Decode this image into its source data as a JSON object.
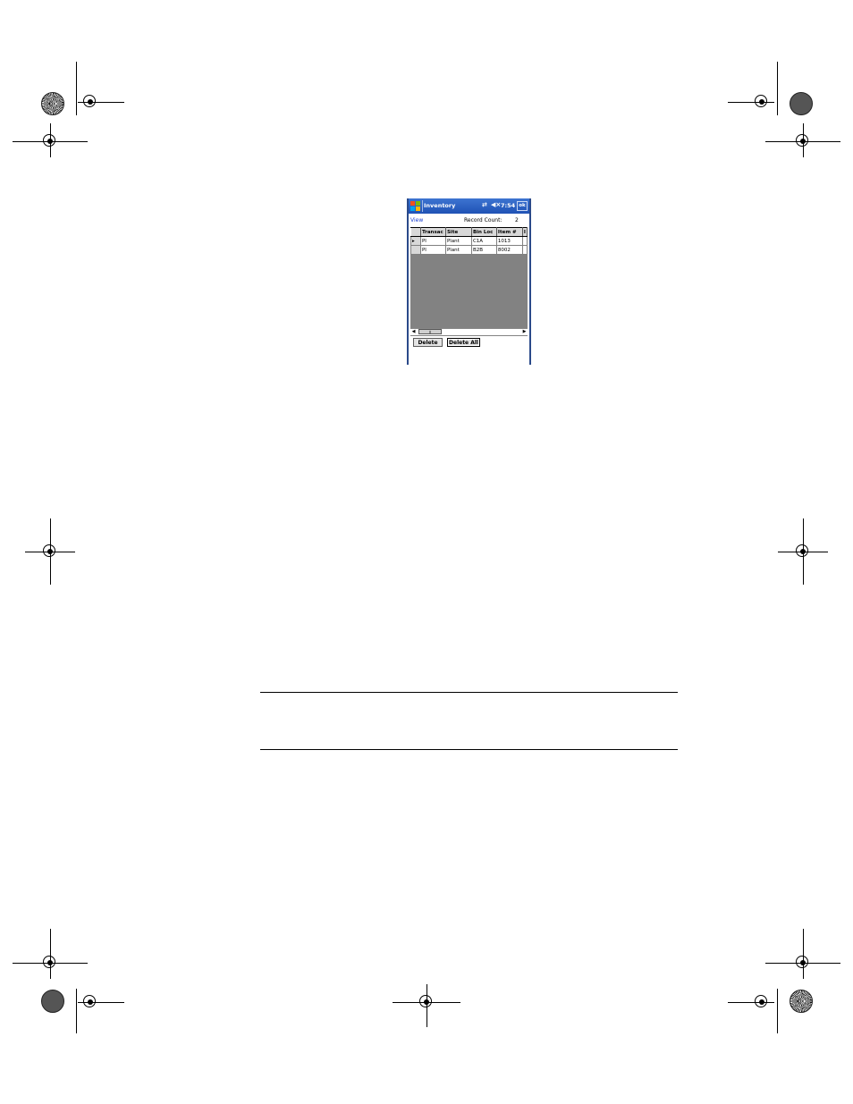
{
  "device": {
    "app_title": "Inventory",
    "status": {
      "connectivity_icon": "sync-arrows-icon",
      "volume_icon": "speaker-icon",
      "time": "7:54",
      "ok_label": "ok"
    },
    "menu": {
      "view_label": "View",
      "record_count_label": "Record Count:",
      "record_count_value": "2"
    },
    "grid": {
      "columns": [
        "Transac",
        "Site",
        "Bin Loc",
        "Item #",
        "I"
      ],
      "rows": [
        [
          "PI",
          "Plant",
          "C1A",
          "1013",
          ""
        ],
        [
          "PI",
          "Plant",
          "B2B",
          "8002",
          ""
        ]
      ]
    },
    "buttons": {
      "delete": "Delete",
      "delete_all": "Delete All"
    }
  }
}
